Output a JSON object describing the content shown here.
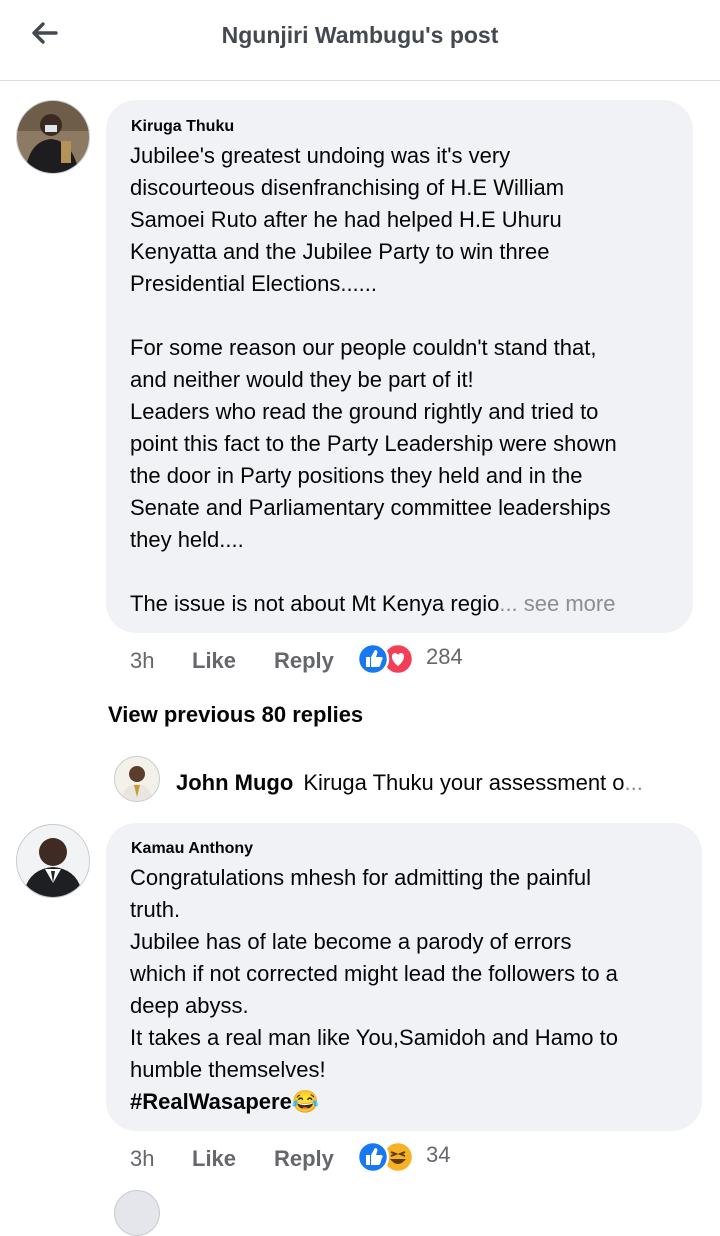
{
  "header": {
    "title": "Ngunjiri Wambugu's post"
  },
  "comments": [
    {
      "author": "Kiruga Thuku",
      "body": "Jubilee's greatest undoing was it's very\ndiscourteous disenfranchising of H.E William\nSamoei Ruto after he had helped H.E Uhuru\nKenyatta and the Jubilee Party to win three\nPresidential Elections......\n\n For some reason our people couldn't stand that,\nand neither would they be part of it!\nLeaders who read the ground rightly and tried to\npoint this fact to the Party Leadership were shown\nthe door in Party positions they held and in the\nSenate and Parliamentary committee leaderships\nthey held....\n\n  The issue is not about Mt Kenya regio",
      "see_more": "... see more",
      "time": "3h",
      "like": "Like",
      "reply": "Reply",
      "reaction_count": "284",
      "reaction_icons": [
        "like-icon",
        "love-icon"
      ]
    },
    {
      "author": "Kamau Anthony",
      "body": "Congratulations mhesh for admitting the painful\ntruth.\nJubilee has of late become a parody of errors\nwhich if not corrected might lead the followers to a\ndeep abyss.\nIt takes a real man like You,Samidoh and Hamo to\nhumble themselves!",
      "hashtag": "#RealWasapere",
      "emoji": "😂",
      "time": "3h",
      "like": "Like",
      "reply": "Reply",
      "reaction_count": "34",
      "reaction_icons": [
        "like-icon",
        "haha-icon"
      ]
    }
  ],
  "view_previous": "View previous 80 replies",
  "latest_reply": {
    "author": "John Mugo",
    "text": "Kiruga Thuku your assessment o",
    "ellipsis": "..."
  },
  "colors": {
    "like_blue": "#1877f2",
    "love_red": "#f33e58",
    "haha_yellow": "#f7b125"
  }
}
